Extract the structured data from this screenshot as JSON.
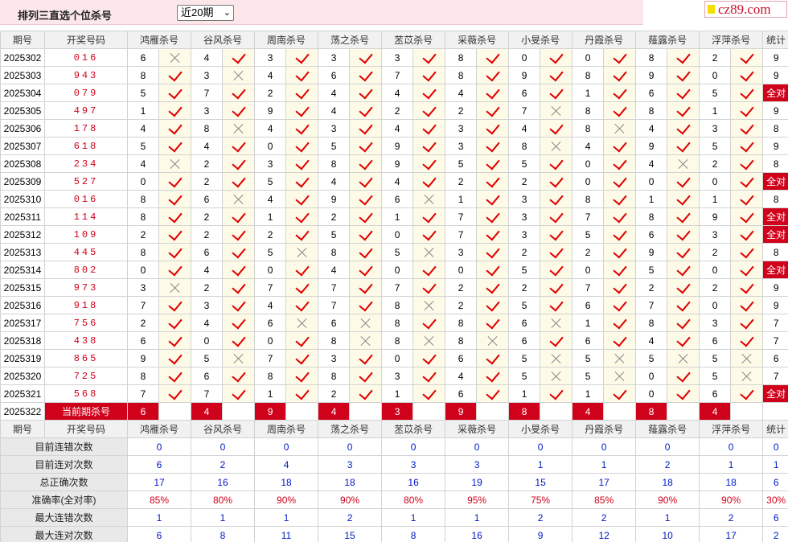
{
  "header": {
    "title": "排列三直选个位杀号",
    "period_select": "近20期",
    "site_logo": "cz89.com"
  },
  "columns": [
    "期号",
    "开奖号码",
    "鸿雁杀号",
    "谷风杀号",
    "周南杀号",
    "荡之杀号",
    "苤苡杀号",
    "采薇杀号",
    "小旻杀号",
    "丹霞杀号",
    "薤露杀号",
    "浮萍杀号",
    "统计"
  ],
  "experts": [
    "鸿雁",
    "谷风",
    "周南",
    "荡之",
    "苤苡",
    "采薇",
    "小旻",
    "丹霞",
    "薤露",
    "浮萍"
  ],
  "rows": [
    {
      "period": "2025302",
      "draw": "016",
      "kills": [
        6,
        4,
        3,
        3,
        3,
        8,
        0,
        0,
        8,
        2
      ],
      "hit": [
        0,
        1,
        1,
        1,
        1,
        1,
        1,
        1,
        1,
        1
      ],
      "stat": "9"
    },
    {
      "period": "2025303",
      "draw": "943",
      "kills": [
        8,
        3,
        4,
        6,
        7,
        8,
        9,
        8,
        9,
        0
      ],
      "hit": [
        1,
        0,
        1,
        1,
        1,
        1,
        1,
        1,
        1,
        1
      ],
      "stat": "9"
    },
    {
      "period": "2025304",
      "draw": "079",
      "kills": [
        5,
        7,
        2,
        4,
        4,
        4,
        6,
        1,
        6,
        5
      ],
      "hit": [
        1,
        1,
        1,
        1,
        1,
        1,
        1,
        1,
        1,
        1
      ],
      "stat": "全对"
    },
    {
      "period": "2025305",
      "draw": "497",
      "kills": [
        1,
        3,
        9,
        4,
        2,
        2,
        7,
        8,
        8,
        1
      ],
      "hit": [
        1,
        1,
        1,
        1,
        1,
        1,
        0,
        1,
        1,
        1
      ],
      "stat": "9"
    },
    {
      "period": "2025306",
      "draw": "178",
      "kills": [
        4,
        8,
        4,
        3,
        4,
        3,
        4,
        8,
        4,
        3
      ],
      "hit": [
        1,
        0,
        1,
        1,
        1,
        1,
        1,
        0,
        1,
        1
      ],
      "stat": "8"
    },
    {
      "period": "2025307",
      "draw": "618",
      "kills": [
        5,
        4,
        0,
        5,
        9,
        3,
        8,
        4,
        9,
        5
      ],
      "hit": [
        1,
        1,
        1,
        1,
        1,
        1,
        0,
        1,
        1,
        1
      ],
      "stat": "9"
    },
    {
      "period": "2025308",
      "draw": "234",
      "kills": [
        4,
        2,
        3,
        8,
        9,
        5,
        5,
        0,
        4,
        2
      ],
      "hit": [
        0,
        1,
        1,
        1,
        1,
        1,
        1,
        1,
        0,
        1
      ],
      "stat": "8"
    },
    {
      "period": "2025309",
      "draw": "527",
      "kills": [
        0,
        2,
        5,
        4,
        4,
        2,
        2,
        0,
        0,
        0
      ],
      "hit": [
        1,
        1,
        1,
        1,
        1,
        1,
        1,
        1,
        1,
        1
      ],
      "stat": "全对"
    },
    {
      "period": "2025310",
      "draw": "016",
      "kills": [
        8,
        6,
        4,
        9,
        6,
        1,
        3,
        8,
        1,
        1
      ],
      "hit": [
        1,
        0,
        1,
        1,
        0,
        1,
        1,
        1,
        1,
        1
      ],
      "stat": "8"
    },
    {
      "period": "2025311",
      "draw": "114",
      "kills": [
        8,
        2,
        1,
        2,
        1,
        7,
        3,
        7,
        8,
        9
      ],
      "hit": [
        1,
        1,
        1,
        1,
        1,
        1,
        1,
        1,
        1,
        1
      ],
      "stat": "全对"
    },
    {
      "period": "2025312",
      "draw": "109",
      "kills": [
        2,
        2,
        2,
        5,
        0,
        7,
        3,
        5,
        6,
        3
      ],
      "hit": [
        1,
        1,
        1,
        1,
        1,
        1,
        1,
        1,
        1,
        1
      ],
      "stat": "全对"
    },
    {
      "period": "2025313",
      "draw": "445",
      "kills": [
        8,
        6,
        5,
        8,
        5,
        3,
        2,
        2,
        9,
        2
      ],
      "hit": [
        1,
        1,
        0,
        1,
        0,
        1,
        1,
        1,
        1,
        1
      ],
      "stat": "8"
    },
    {
      "period": "2025314",
      "draw": "802",
      "kills": [
        0,
        4,
        0,
        4,
        0,
        0,
        5,
        0,
        5,
        0
      ],
      "hit": [
        1,
        1,
        1,
        1,
        1,
        1,
        1,
        1,
        1,
        1
      ],
      "stat": "全对"
    },
    {
      "period": "2025315",
      "draw": "973",
      "kills": [
        3,
        2,
        7,
        7,
        7,
        2,
        2,
        7,
        2,
        2
      ],
      "hit": [
        0,
        1,
        1,
        1,
        1,
        1,
        1,
        1,
        1,
        1
      ],
      "stat": "9"
    },
    {
      "period": "2025316",
      "draw": "918",
      "kills": [
        7,
        3,
        4,
        7,
        8,
        2,
        5,
        6,
        7,
        0
      ],
      "hit": [
        1,
        1,
        1,
        1,
        0,
        1,
        1,
        1,
        1,
        1
      ],
      "stat": "9"
    },
    {
      "period": "2025317",
      "draw": "756",
      "kills": [
        2,
        4,
        6,
        6,
        8,
        8,
        6,
        1,
        8,
        3
      ],
      "hit": [
        1,
        1,
        0,
        0,
        1,
        1,
        0,
        1,
        1,
        1
      ],
      "stat": "7"
    },
    {
      "period": "2025318",
      "draw": "438",
      "kills": [
        6,
        0,
        0,
        8,
        8,
        8,
        6,
        6,
        4,
        6
      ],
      "hit": [
        1,
        1,
        1,
        0,
        0,
        0,
        1,
        1,
        1,
        1
      ],
      "stat": "7"
    },
    {
      "period": "2025319",
      "draw": "865",
      "kills": [
        9,
        5,
        7,
        3,
        0,
        6,
        5,
        5,
        5,
        5
      ],
      "hit": [
        1,
        0,
        1,
        1,
        1,
        1,
        0,
        0,
        0,
        0
      ],
      "stat": "6"
    },
    {
      "period": "2025320",
      "draw": "725",
      "kills": [
        8,
        6,
        8,
        8,
        3,
        4,
        5,
        5,
        0,
        5
      ],
      "hit": [
        1,
        1,
        1,
        1,
        1,
        1,
        0,
        0,
        1,
        0
      ],
      "stat": "7"
    },
    {
      "period": "2025321",
      "draw": "568",
      "kills": [
        7,
        7,
        1,
        2,
        1,
        6,
        1,
        1,
        0,
        6
      ],
      "hit": [
        1,
        1,
        1,
        1,
        1,
        1,
        1,
        1,
        1,
        1
      ],
      "stat": "全对"
    }
  ],
  "current": {
    "period": "2025322",
    "label": "当前期杀号",
    "kills": [
      6,
      4,
      9,
      4,
      3,
      9,
      8,
      4,
      8,
      4
    ]
  },
  "stats": [
    {
      "label": "目前连错次数",
      "values": [
        "0",
        "0",
        "0",
        "0",
        "0",
        "0",
        "0",
        "0",
        "0",
        "0",
        "0"
      ],
      "color": "blue"
    },
    {
      "label": "目前连对次数",
      "values": [
        "6",
        "2",
        "4",
        "3",
        "3",
        "3",
        "1",
        "1",
        "2",
        "1",
        "1"
      ],
      "color": "blue"
    },
    {
      "label": "总正确次数",
      "values": [
        "17",
        "16",
        "18",
        "18",
        "16",
        "19",
        "15",
        "17",
        "18",
        "18",
        "6"
      ],
      "color": "blue"
    },
    {
      "label": "准确率(全对率)",
      "values": [
        "85%",
        "80%",
        "90%",
        "90%",
        "80%",
        "95%",
        "75%",
        "85%",
        "90%",
        "90%",
        "30%"
      ],
      "color": "red"
    },
    {
      "label": "最大连错次数",
      "values": [
        "1",
        "1",
        "1",
        "2",
        "1",
        "1",
        "2",
        "2",
        "1",
        "2",
        "6"
      ],
      "color": "blue"
    },
    {
      "label": "最大连对次数",
      "values": [
        "6",
        "8",
        "11",
        "15",
        "8",
        "16",
        "9",
        "12",
        "10",
        "17",
        "2"
      ],
      "color": "blue"
    }
  ]
}
